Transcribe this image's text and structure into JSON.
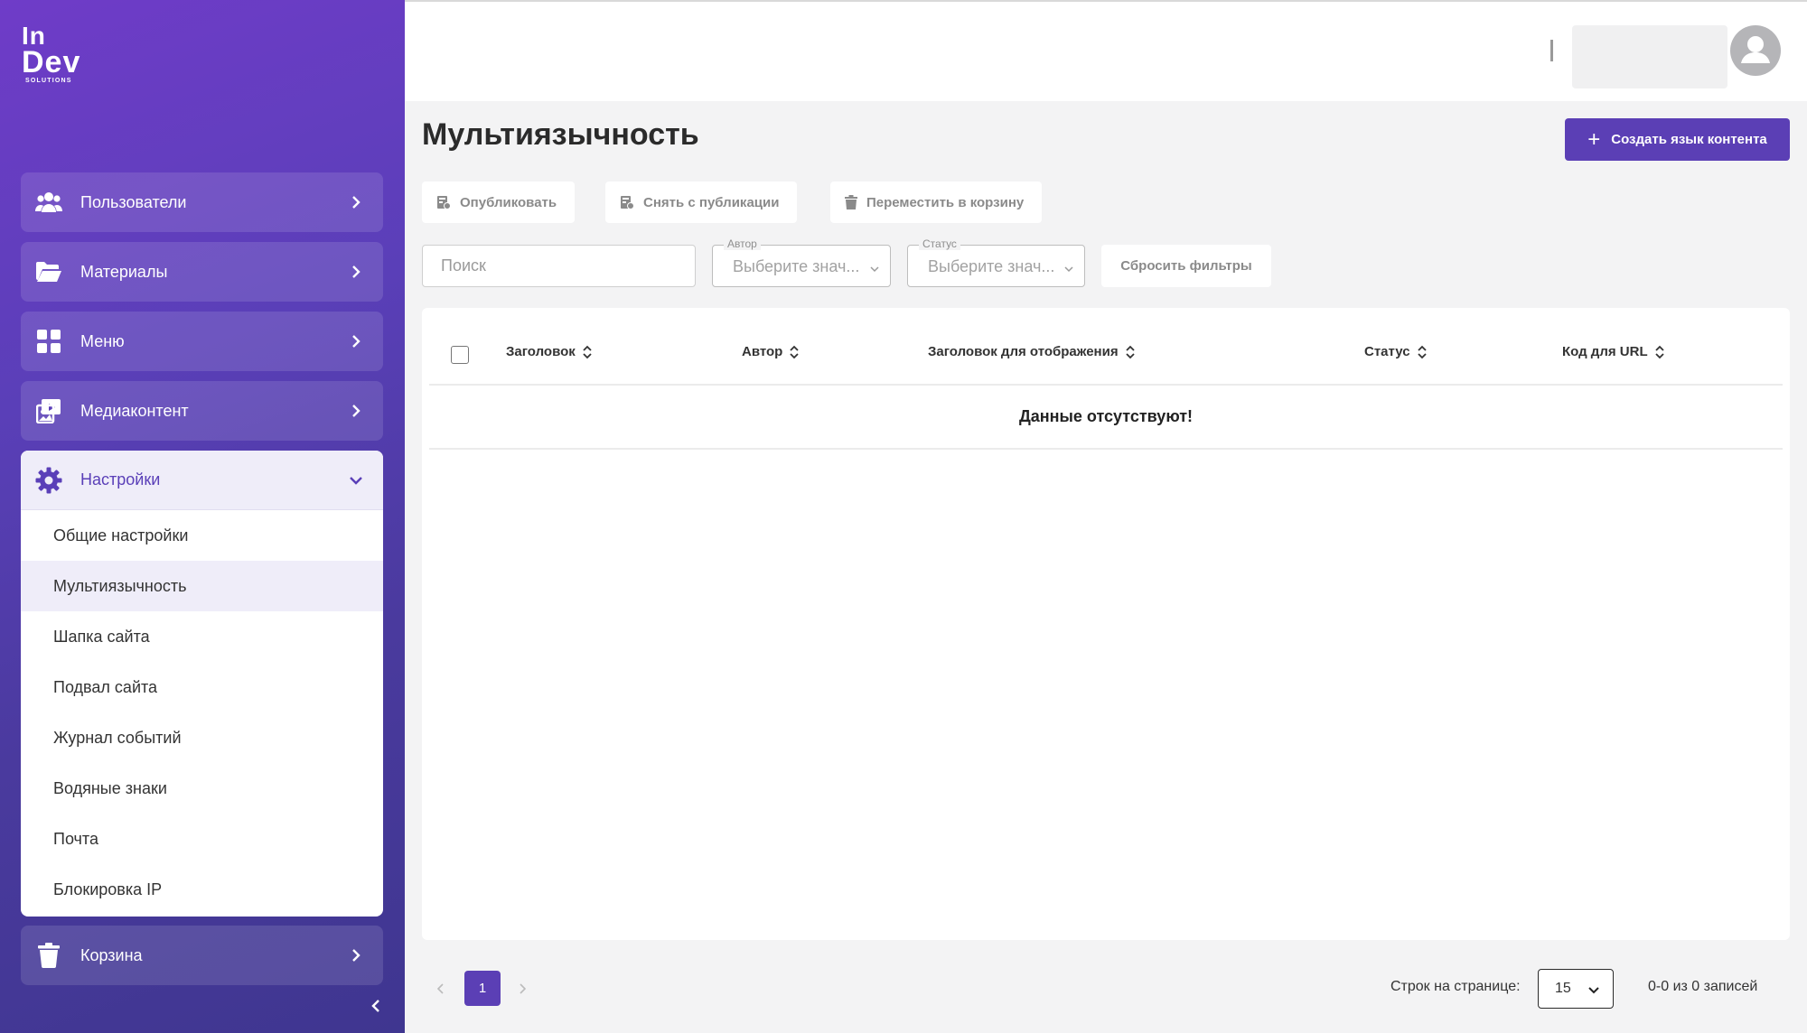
{
  "brand": {
    "line1": "In",
    "line2": "Dev",
    "line3": "SOLUTIONS"
  },
  "sidebar": {
    "items": [
      {
        "label": "Пользователи",
        "icon": "users-icon"
      },
      {
        "label": "Материалы",
        "icon": "folder-open-icon"
      },
      {
        "label": "Меню",
        "icon": "grid-icon"
      },
      {
        "label": "Медиаконтент",
        "icon": "media-icon"
      },
      {
        "label": "Настройки",
        "icon": "gear-icon",
        "expanded": true
      },
      {
        "label": "Корзина",
        "icon": "trash-icon"
      }
    ],
    "settings_sub": [
      "Общие настройки",
      "Мультиязычность",
      "Шапка сайта",
      "Подвал сайта",
      "Журнал событий",
      "Водяные знаки",
      "Почта",
      "Блокировка IP"
    ],
    "active_sub": "Мультиязычность"
  },
  "page": {
    "title": "Мультиязычность",
    "create_button": "Создать язык контента"
  },
  "actions": {
    "publish": "Опубликовать",
    "unpublish": "Снять с публикации",
    "to_trash": "Переместить в корзину"
  },
  "filters": {
    "search_placeholder": "Поиск",
    "author_label": "Автор",
    "author_value": "Выберите знач...",
    "status_label": "Статус",
    "status_value": "Выберите знач...",
    "reset": "Сбросить фильтры"
  },
  "table": {
    "columns": [
      "Заголовок",
      "Автор",
      "Заголовок для отображения",
      "Статус",
      "Код для URL"
    ],
    "empty_text": "Данные отсутствуют!"
  },
  "pagination": {
    "current_page": "1",
    "rows_label": "Строк на странице:",
    "rows_value": "15",
    "records": "0-0 из 0 записей"
  },
  "colors": {
    "accent": "#5b3fb5",
    "sidebar_top": "#6f3cc8",
    "sidebar_bottom": "#3f3690"
  }
}
